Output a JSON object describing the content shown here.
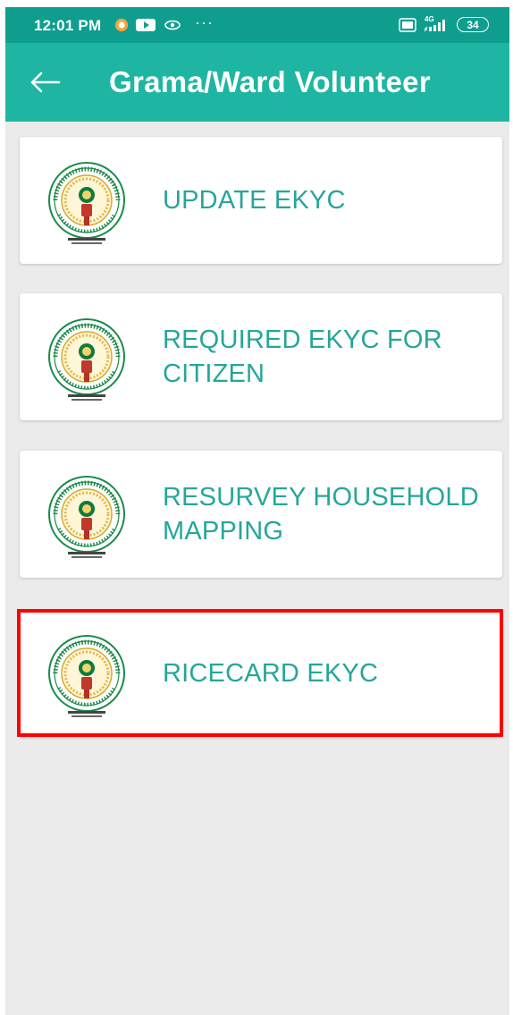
{
  "status_bar": {
    "time": "12:01 PM",
    "more": "···",
    "network_label": "4G",
    "battery": "34",
    "volte_label": "Vo LTE"
  },
  "app_bar": {
    "title": "Grama/Ward Volunteer",
    "back_icon": "arrow-left-icon"
  },
  "menu_items": [
    {
      "label": "UPDATE EKYC",
      "icon": "ap-emblem-icon"
    },
    {
      "label": "REQUIRED EKYC FOR CITIZEN",
      "icon": "ap-emblem-icon"
    },
    {
      "label": "RESURVEY HOUSEHOLD MAPPING",
      "icon": "ap-emblem-icon"
    },
    {
      "label": "RICECARD EKYC",
      "icon": "ap-emblem-icon",
      "highlighted": true
    }
  ],
  "colors": {
    "status_bar": "#0f9e8e",
    "app_bar": "#1eb6a3",
    "item_text": "#26a69a",
    "highlight": "#ff0000",
    "background": "#ebebeb"
  }
}
